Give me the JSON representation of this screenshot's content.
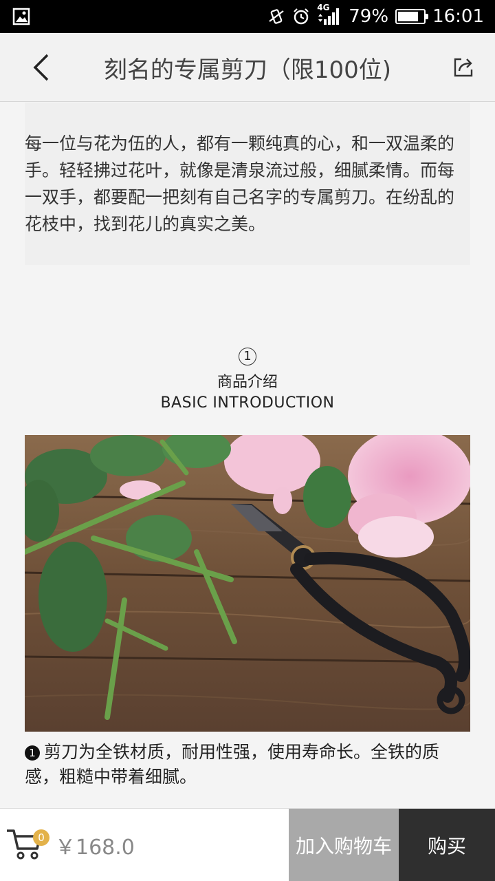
{
  "status_bar": {
    "network": "4G",
    "battery": "79%",
    "battery_level": 0.79,
    "time": "16:01",
    "icons": [
      "image-icon",
      "vibrate-icon",
      "alarm-icon",
      "signal-icon",
      "battery-icon"
    ]
  },
  "header": {
    "title": "刻名的专属剪刀（限100位)",
    "back_icon": "chevron-left-icon",
    "share_icon": "share-icon"
  },
  "intro": {
    "text": "每一位与花为伍的人，都有一颗纯真的心，和一双温柔的手。轻轻拂过花叶，就像是清泉流过般，细腻柔情。而每一双手，都要配一把刻有自己名字的专属剪刀。在纷乱的花枝中，找到花儿的真实之美。"
  },
  "section": {
    "number": "1",
    "title_cn": "商品介绍",
    "title_en": "BASIC INTRODUCTION"
  },
  "product": {
    "caption_number": "1",
    "caption": "剪刀为全铁材质，耐用性强，使用寿命长。全铁的质感，粗糙中带着细腻。"
  },
  "bottom_bar": {
    "cart_count": "0",
    "price": "￥168.0",
    "add_to_cart": "加入购物车",
    "buy": "购买"
  },
  "colors": {
    "status_bar_bg": "#000000",
    "header_bg": "#f2f2f2",
    "page_bg": "#f4f4f4",
    "badge": "#e3b24a",
    "add_cart_bg": "#a9a9a9",
    "buy_bg": "#2f2f2f"
  }
}
